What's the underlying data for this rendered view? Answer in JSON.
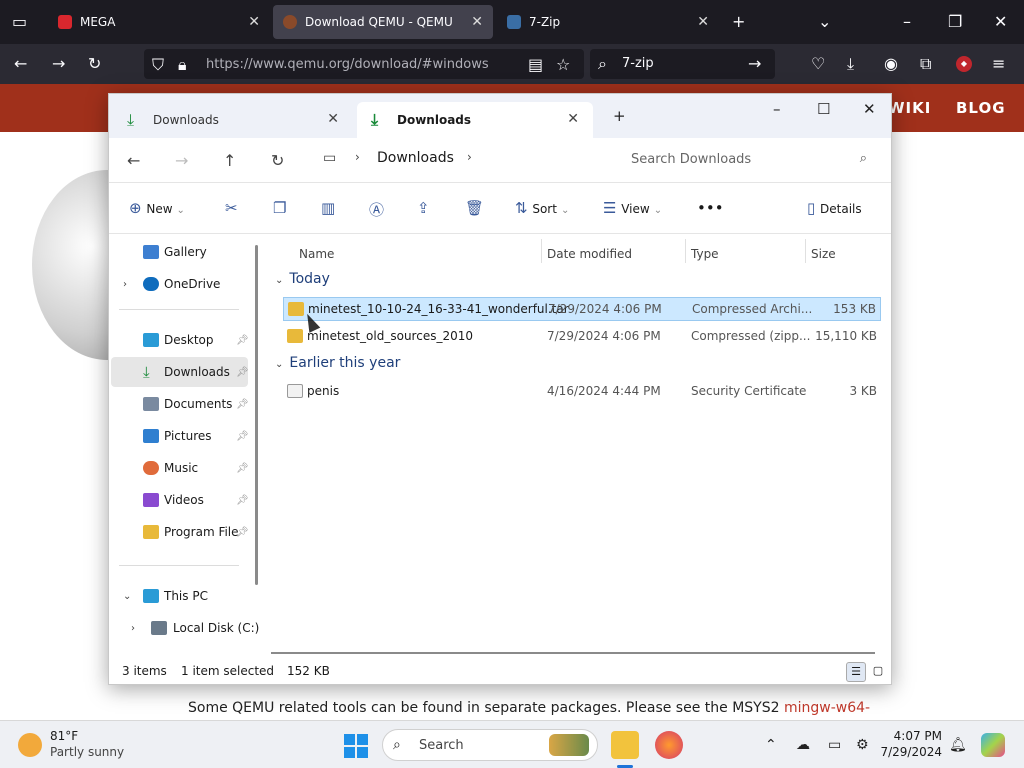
{
  "browser": {
    "tabs": [
      {
        "label": "MEGA",
        "icon_color": "#d9272e"
      },
      {
        "label": "Download QEMU - QEMU",
        "icon_color": "#8a4a2a"
      },
      {
        "label": "7-Zip",
        "icon_color": "#3a6ea5"
      }
    ],
    "url": "https://www.qemu.org/download/#windows",
    "search_query": "7-zip"
  },
  "page": {
    "nav_items": [
      "WIKI",
      "BLOG"
    ],
    "footnote_text": "Some QEMU related tools can be found in separate packages. Please see the MSYS2",
    "footnote_link": "mingw-w64-"
  },
  "explorer": {
    "tabs": [
      {
        "label": "Downloads"
      },
      {
        "label": "Downloads"
      }
    ],
    "breadcrumb": "Downloads",
    "search_placeholder": "Search Downloads",
    "commands": {
      "new": "New",
      "sort": "Sort",
      "view": "View",
      "details": "Details"
    },
    "nav": [
      {
        "label": "Gallery",
        "icon_color": "#3d7fd1"
      },
      {
        "label": "OneDrive",
        "icon_color": "#0f6cbd"
      },
      {
        "label": "Desktop",
        "icon_color": "#2a9bd6"
      },
      {
        "label": "Downloads",
        "icon_color": "#1a8a3a"
      },
      {
        "label": "Documents",
        "icon_color": "#7a8aa0"
      },
      {
        "label": "Pictures",
        "icon_color": "#2f7fd0"
      },
      {
        "label": "Music",
        "icon_color": "#e06b3b"
      },
      {
        "label": "Videos",
        "icon_color": "#8a4ad0"
      },
      {
        "label": "Program File",
        "icon_color": "#e8b93a"
      },
      {
        "label": "This PC",
        "icon_color": "#2a9bd6"
      },
      {
        "label": "Local Disk (C:)",
        "icon_color": "#6a7a8a"
      }
    ],
    "columns": {
      "name": "Name",
      "date": "Date modified",
      "type": "Type",
      "size": "Size"
    },
    "groups": {
      "today": "Today",
      "earlier": "Earlier this year"
    },
    "files": [
      {
        "name": "minetest_10-10-24_16-33-41_wonderful.tar",
        "date": "7/29/2024 4:06 PM",
        "type": "Compressed Archi...",
        "size": "153 KB"
      },
      {
        "name": "minetest_old_sources_2010",
        "date": "7/29/2024 4:06 PM",
        "type": "Compressed (zipp...",
        "size": "15,110 KB"
      },
      {
        "name": "penis",
        "date": "4/16/2024 4:44 PM",
        "type": "Security Certificate",
        "size": "3 KB"
      }
    ],
    "status": {
      "count": "3 items",
      "selected": "1 item selected",
      "size": "152 KB"
    }
  },
  "taskbar": {
    "weather_temp": "81°F",
    "weather_desc": "Partly sunny",
    "search_label": "Search",
    "time": "4:07 PM",
    "date": "7/29/2024"
  }
}
